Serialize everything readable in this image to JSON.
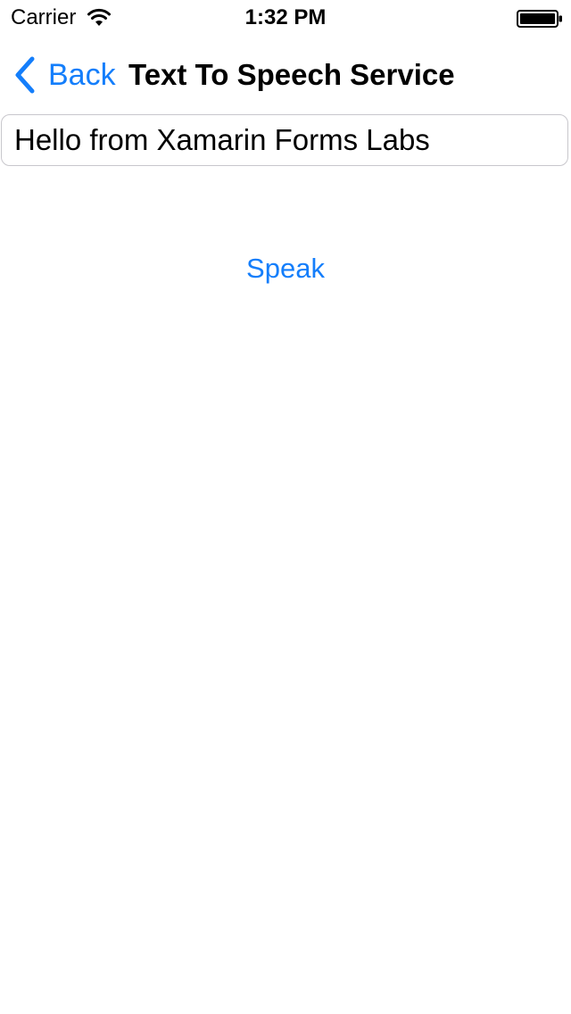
{
  "status_bar": {
    "carrier": "Carrier",
    "time": "1:32 PM",
    "wifi_icon": "wifi-icon",
    "battery_icon": "battery-icon"
  },
  "nav_bar": {
    "back_label": "Back",
    "back_icon": "chevron-left-icon",
    "title": "Text To Speech Service"
  },
  "main": {
    "text_input_value": "Hello from Xamarin Forms Labs",
    "speak_label": "Speak"
  },
  "colors": {
    "accent": "#147efb",
    "text": "#000000",
    "background": "#ffffff",
    "input_border": "#c8c7cc"
  }
}
